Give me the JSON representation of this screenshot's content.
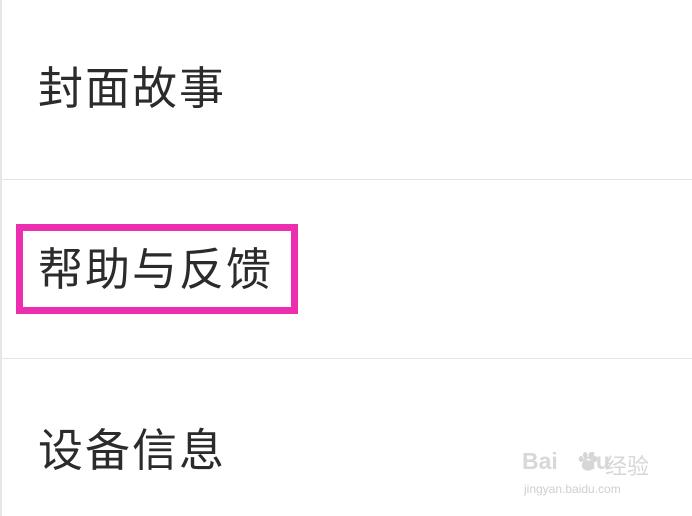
{
  "settings_menu": {
    "items": [
      {
        "label": "封面故事"
      },
      {
        "label": "帮助与反馈"
      },
      {
        "label": "设备信息"
      }
    ]
  },
  "highlight": {
    "target": "帮助与反馈",
    "color": "#ec2fb0"
  },
  "watermark": {
    "logo_text": "Bai",
    "logo_suffix": "du",
    "label": "经验",
    "url": "jingyan.baidu.com"
  }
}
